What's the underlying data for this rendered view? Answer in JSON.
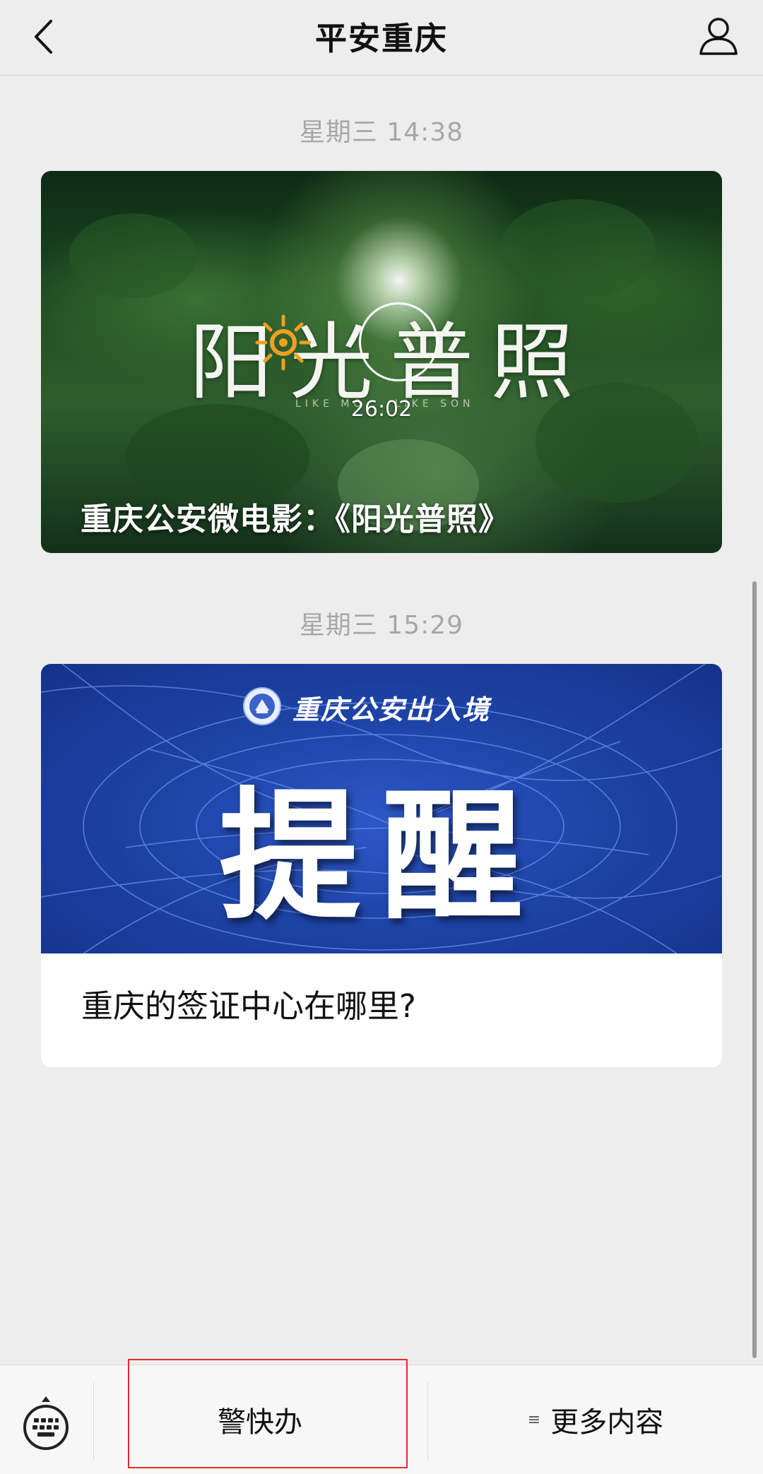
{
  "navbar": {
    "title": "平安重庆",
    "back_icon": "chevron-left-icon",
    "profile_icon": "user-profile-icon"
  },
  "messages": [
    {
      "timestamp": "星期三 14:38",
      "type": "video",
      "art_title": "阳光普照",
      "art_subtitle": "LIKE MO... LIKE SON",
      "duration": "26:02",
      "caption": "重庆公安微电影：《阳光普照》"
    },
    {
      "timestamp": "星期三 15:29",
      "type": "article",
      "banner_subtitle": "重庆公安出入境",
      "banner_title": "提醒",
      "title": "重庆的签证中心在哪里?"
    }
  ],
  "bottom_menu": {
    "keyboard_icon": "keyboard-icon",
    "items": [
      {
        "label": "警快办"
      },
      {
        "label": "更多内容",
        "icon": "≡"
      }
    ]
  },
  "colors": {
    "background": "#ededed",
    "highlight": "#e52b2b",
    "banner_blue": "#1e44a8"
  }
}
